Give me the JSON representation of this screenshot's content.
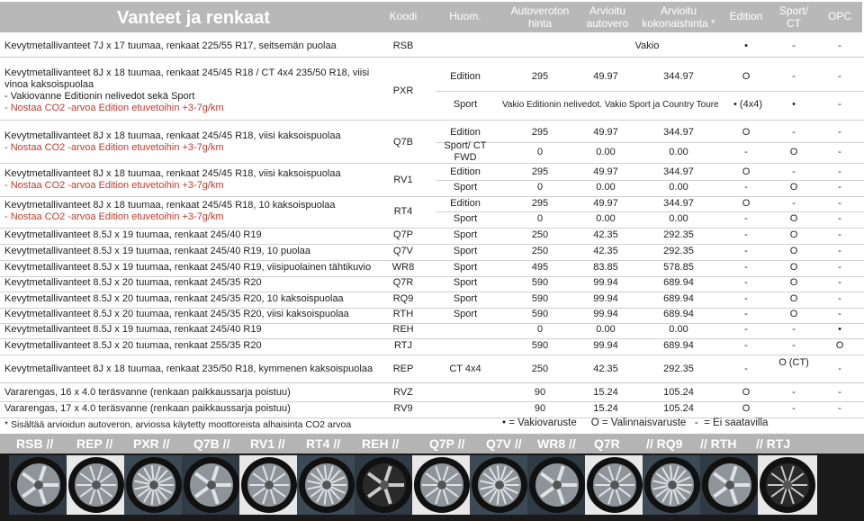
{
  "header": {
    "title": "Vanteet ja renkaat",
    "cols": [
      "Koodi",
      "Huom.",
      "Autoveroton hinta",
      "Arvioitu autovero",
      "Arvioitu kokonaishinta *",
      "Edition",
      "Sport/ CT",
      "OPC"
    ]
  },
  "rows": [
    {
      "desc": [
        "Kevytmetallivanteet 7J x 17 tuumaa, renkaat 225/55 R17, seitsemän puolaa"
      ],
      "code": "RSB",
      "sub": [
        {
          "note": "Vakio",
          "price": "",
          "tax": "",
          "total": "",
          "ed": "•",
          "sp": "-",
          "opc": "-"
        }
      ]
    },
    {
      "desc": [
        "Kevytmetallivanteet 8J x 18 tuumaa,  renkaat 245/45 R18 / CT 4x4 235/50 R18, viisi",
        "vinoa kaksoispuolaa",
        "- Vakiovanne Editionin nelivedot sekä Sport"
      ],
      "red": "- Nostaa CO2 -arvoa Edition etuvetoihin +3-7g/km",
      "code": "PXR",
      "sub": [
        {
          "note": "Edition",
          "price": "295",
          "tax": "49.97",
          "total": "344.97",
          "ed": "O",
          "sp": "-",
          "opc": "-"
        },
        {
          "note": "Sport",
          "price": "Vakio Editionin nelivedot. Vakio Sport ja Country Tourer",
          "tax": "",
          "total": "",
          "ed": "• (4x4)",
          "sp": "•",
          "opc": "-"
        }
      ]
    },
    {
      "desc": [
        "Kevytmetallivanteet 8J x 18 tuumaa, renkaat 245/45 R18, viisi kaksoispuolaa"
      ],
      "red": "- Nostaa CO2 -arvoa Edition etuvetoihin +3-7g/km",
      "code": "Q7B",
      "sub": [
        {
          "note": "Edition",
          "price": "295",
          "tax": "49.97",
          "total": "344.97",
          "ed": "O",
          "sp": "-",
          "opc": "-"
        },
        {
          "note": "Sport/ CT FWD",
          "price": "0",
          "tax": "0.00",
          "total": "0.00",
          "ed": "-",
          "sp": "O",
          "opc": "-"
        }
      ]
    },
    {
      "desc": [
        "Kevytmetallivanteet 8J x 18 tuumaa, renkaat 245/45 R18, viisi kaksoispuolaa"
      ],
      "red": "- Nostaa CO2 -arvoa Edition etuvetoihin +3-7g/km",
      "code": "RV1",
      "sub": [
        {
          "note": "Edition",
          "price": "295",
          "tax": "49.97",
          "total": "344.97",
          "ed": "O",
          "sp": "-",
          "opc": "-"
        },
        {
          "note": "Sport",
          "price": "0",
          "tax": "0.00",
          "total": "0.00",
          "ed": "-",
          "sp": "O",
          "opc": "-"
        }
      ]
    },
    {
      "desc": [
        "Kevytmetallivanteet 8J x 18 tuumaa, renkaat 245/45 R18, 10 kaksoispuolaa"
      ],
      "red": "- Nostaa CO2 -arvoa Edition etuvetoihin +3-7g/km",
      "code": "RT4",
      "sub": [
        {
          "note": "Edition",
          "price": "295",
          "tax": "49.97",
          "total": "344.97",
          "ed": "O",
          "sp": "-",
          "opc": "-"
        },
        {
          "note": "Sport",
          "price": "0",
          "tax": "0.00",
          "total": "0.00",
          "ed": "-",
          "sp": "O",
          "opc": "-"
        }
      ]
    },
    {
      "desc": [
        "Kevytmetallivanteet 8.5J x 19 tuumaa, renkaat 245/40 R19"
      ],
      "code": "Q7P",
      "sub": [
        {
          "note": "Sport",
          "price": "250",
          "tax": "42.35",
          "total": "292.35",
          "ed": "-",
          "sp": "O",
          "opc": "-"
        }
      ]
    },
    {
      "desc": [
        "Kevytmetallivanteet 8.5J x 19 tuumaa, renkaat 245/40 R19, 10 puolaa"
      ],
      "code": "Q7V",
      "sub": [
        {
          "note": "Sport",
          "price": "250",
          "tax": "42.35",
          "total": "292.35",
          "ed": "-",
          "sp": "O",
          "opc": "-"
        }
      ]
    },
    {
      "desc": [
        "Kevytmetallivanteet 8.5J x 19 tuumaa, renkaat 245/40 R19, viisipuolainen tähtikuvio"
      ],
      "code": "WR8",
      "sub": [
        {
          "note": "Sport",
          "price": "495",
          "tax": "83.85",
          "total": "578.85",
          "ed": "-",
          "sp": "O",
          "opc": "-"
        }
      ]
    },
    {
      "desc": [
        "Kevytmetallivanteet 8.5J x 20 tuumaa, renkaat 245/35 R20"
      ],
      "code": "Q7R",
      "sub": [
        {
          "note": "Sport",
          "price": "590",
          "tax": "99.94",
          "total": "689.94",
          "ed": "-",
          "sp": "O",
          "opc": "-"
        }
      ]
    },
    {
      "desc": [
        "Kevytmetallivanteet 8.5J x 20 tuumaa, renkaat 245/35 R20, 10 kaksoispuolaa"
      ],
      "code": "RQ9",
      "sub": [
        {
          "note": "Sport",
          "price": "590",
          "tax": "99.94",
          "total": "689.94",
          "ed": "-",
          "sp": "O",
          "opc": "-"
        }
      ]
    },
    {
      "desc": [
        "Kevytmetallivanteet 8.5J x 20 tuumaa, renkaat 245/35 R20, viisi kaksoispuolaa"
      ],
      "code": "RTH",
      "sub": [
        {
          "note": "Sport",
          "price": "590",
          "tax": "99.94",
          "total": "689.94",
          "ed": "-",
          "sp": "O",
          "opc": "-"
        }
      ]
    },
    {
      "desc": [
        "Kevytmetallivanteet 8.5J x 19 tuumaa, renkaat 245/40 R19"
      ],
      "code": "REH",
      "sub": [
        {
          "note": "",
          "price": "0",
          "tax": "0.00",
          "total": "0.00",
          "ed": "-",
          "sp": "-",
          "opc": "•"
        }
      ]
    },
    {
      "desc": [
        "Kevytmetallivanteet 8.5J x 20 tuumaa, renkaat 255/35 R20"
      ],
      "code": "RTJ",
      "sub": [
        {
          "note": "",
          "price": "590",
          "tax": "99.94",
          "total": "689.94",
          "ed": "-",
          "sp": "-",
          "opc": "O"
        }
      ]
    },
    {
      "desc": [
        "Kevytmetallivanteet 8J x 18 tuumaa,  renkaat 235/50 R18, kymmenen kaksoispuolaa"
      ],
      "code": "REP",
      "sub": [
        {
          "note": "CT 4x4",
          "price": "250",
          "tax": "42.35",
          "total": "292.35",
          "ed": "-",
          "sp": "O (CT)",
          "opc": "-"
        }
      ]
    },
    {
      "desc": [
        "Vararengas, 16 x 4.0 teräsvanne (renkaan paikkaussarja poistuu)"
      ],
      "code": "RVZ",
      "sub": [
        {
          "note": "",
          "price": "90",
          "tax": "15.24",
          "total": "105.24",
          "ed": "O",
          "sp": "-",
          "opc": "-"
        }
      ]
    },
    {
      "desc": [
        "Vararengas, 17 x 4.0 teräsvanne (renkaan paikkaussarja poistuu)"
      ],
      "code": "RV9",
      "sub": [
        {
          "note": "",
          "price": "90",
          "tax": "15.24",
          "total": "105.24",
          "ed": "O",
          "sp": "-",
          "opc": "-"
        }
      ]
    }
  ],
  "footer": {
    "note": "* Sisältää arvioidun autoveron, arviossa käytetty moottoreista alhaisinta CO2 arvoa",
    "legend": "• = Vakiovaruste     O = Valinnaisvaruste   -  = Ei saatavilla"
  },
  "wheel_labels": [
    "RSB //",
    "REP //",
    "PXR //",
    "Q7B //",
    "RV1 //",
    "RT4 //",
    "REH //",
    "Q7P //",
    "Q7V //",
    "WR8 //",
    "Q7R",
    "// RQ9",
    "// RTH",
    "// RTJ"
  ]
}
